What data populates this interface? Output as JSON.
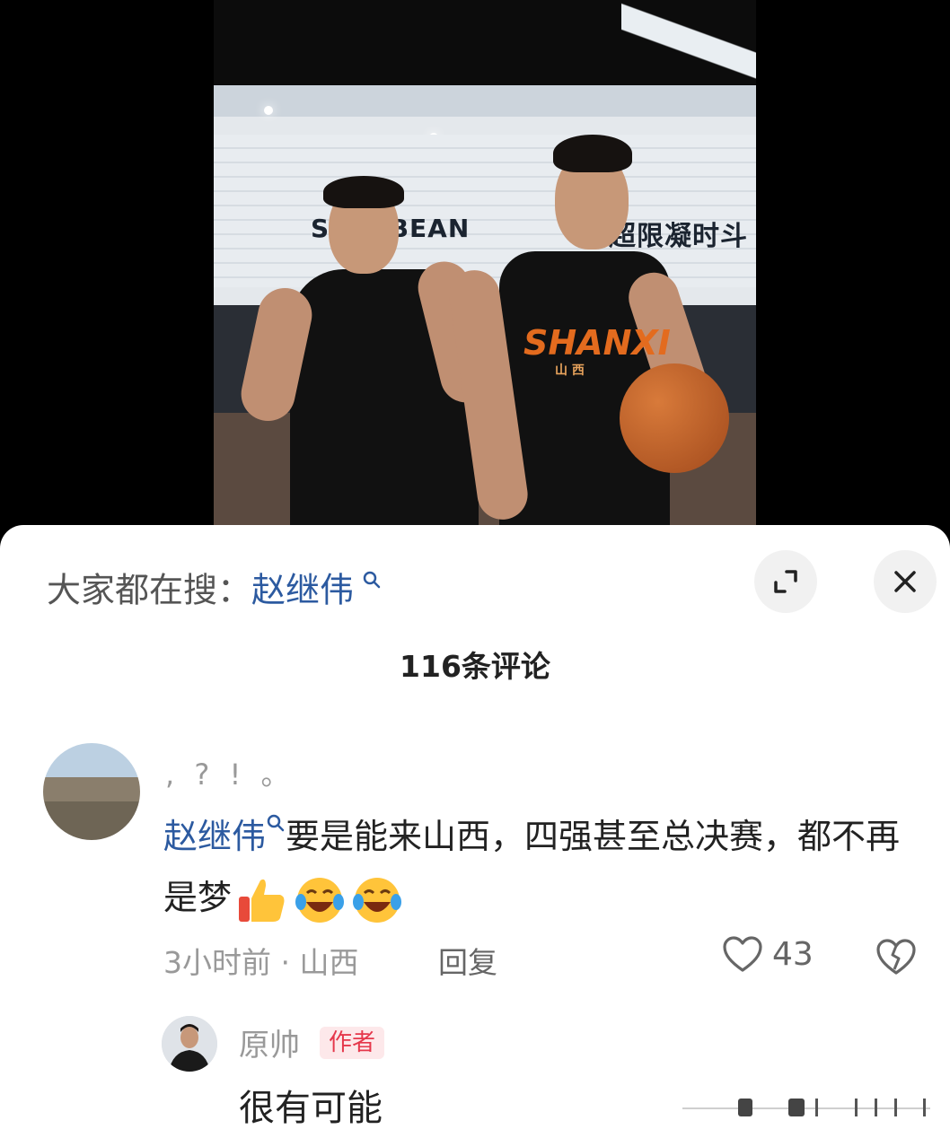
{
  "search_bar": {
    "prefix": "大家都在搜：",
    "keyword": "赵继伟"
  },
  "comments_header": {
    "count_label": "116条评论"
  },
  "photo": {
    "banner_text_left": "S  ZU BEAN",
    "banner_text_right": "超限凝时斗场",
    "jersey_text": "SHANXI",
    "jersey_sub": "山 西"
  },
  "comment": {
    "username": ", ? ! 。",
    "mention": "赵继伟",
    "body": "要是能来山西，四强甚至总决赛，都不再是梦",
    "emojis": [
      "thumbs-up-emoji",
      "laughing-crying-emoji",
      "laughing-crying-emoji"
    ],
    "time": "3小时前",
    "location": "山西",
    "meta_separator": " · ",
    "reply_label": "回复",
    "like_count": "43"
  },
  "reply": {
    "username": "原帅",
    "badge": "作者",
    "body": "很有可能"
  },
  "colors": {
    "link": "#2c5aa0",
    "badge_bg": "#fde8ea",
    "badge_text": "#e5374b",
    "muted": "#999999"
  }
}
